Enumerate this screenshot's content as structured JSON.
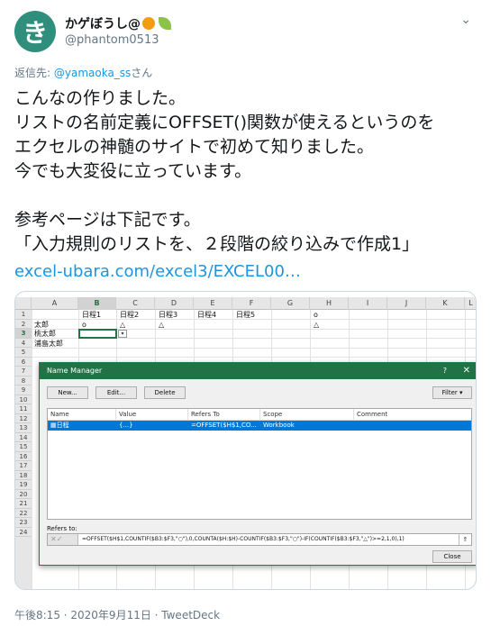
{
  "tweet": {
    "avatar_letter": "き",
    "display_name": "かゲぼうし@",
    "handle": "@phantom0513",
    "reply_prefix": "返信先: ",
    "reply_mention": "@yamaoka_ss",
    "reply_suffix": "さん",
    "text": "こんなの作りました。\nリストの名前定義にOFFSET()関数が使えるというのを\nエクセルの神髄のサイトで初めて知りました。\n今でも大変役に立っています。\n\n参考ページは下記です。\n「入力規則のリストを、２段階の絞り込みで作成1」",
    "link": "excel-ubara.com/excel3/EXCEL00…",
    "footer": "午後8:15 · 2020年9月11日 · TweetDeck"
  },
  "sheet": {
    "columns": [
      "A",
      "B",
      "C",
      "D",
      "E",
      "F",
      "G",
      "H",
      "I",
      "J",
      "K",
      "L"
    ],
    "rows": [
      "1",
      "2",
      "3",
      "4",
      "5",
      "6",
      "7",
      "8",
      "9",
      "10",
      "11",
      "12",
      "13",
      "14",
      "15",
      "16",
      "17",
      "18",
      "19",
      "20",
      "21",
      "22",
      "23",
      "24"
    ],
    "row1": [
      "日程1",
      "日程2",
      "日程3",
      "日程4",
      "日程5"
    ],
    "h1": "o",
    "names": [
      "太郎",
      "桃太郎",
      "浦島太郎"
    ],
    "row2": [
      "o",
      "△",
      "△"
    ],
    "h2": "△",
    "dropdown": "▾"
  },
  "dialog": {
    "title": "Name Manager",
    "help": "?",
    "close": "✕",
    "new_btn": "New...",
    "edit_btn": "Edit...",
    "delete_btn": "Delete",
    "filter_btn": "Filter ▾",
    "headers": [
      "Name",
      "Value",
      "Refers To",
      "Scope",
      "Comment"
    ],
    "row": {
      "name": "日程",
      "value": "{...}",
      "refers_to": "=OFFSET($H$1,CO...",
      "scope": "Workbook",
      "comment": ""
    },
    "refers_label": "Refers to:",
    "refers_icons": "✕✓",
    "refers_formula": "=OFFSET($H$1,COUNTIF($B3:$F3,\"○\"),0,COUNTA($H:$H)-COUNTIF($B3:$F3,\"○\")-IF(COUNTIF($B3:$F3,\"△\")>=2,1,0),1)",
    "collapse": "⇑",
    "close_btn": "Close"
  }
}
